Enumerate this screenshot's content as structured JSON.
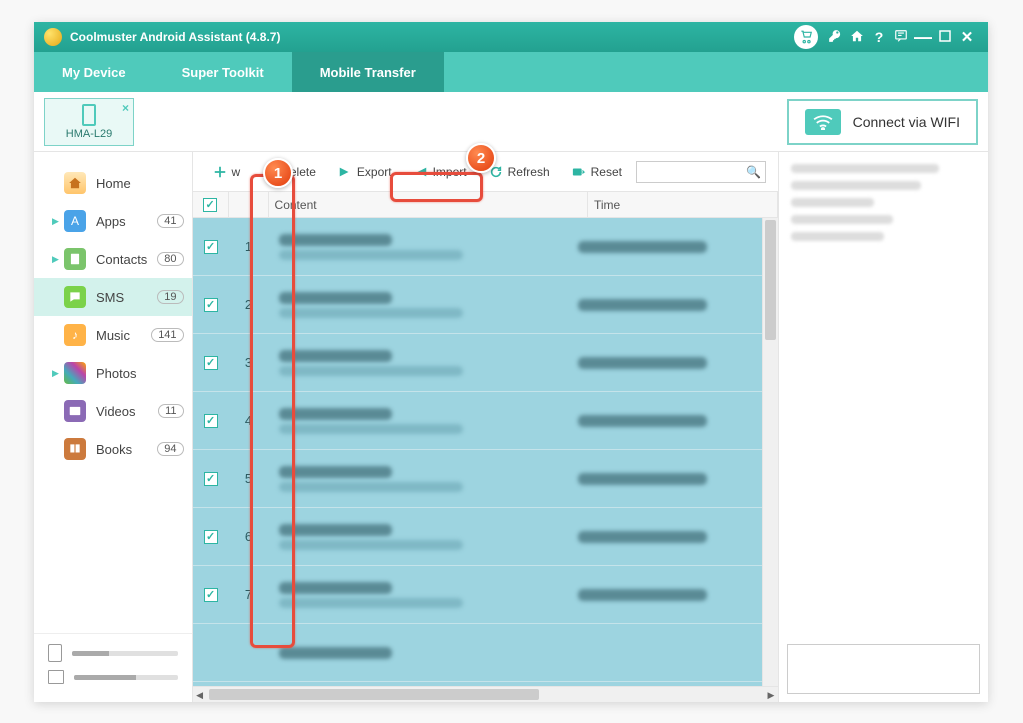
{
  "app": {
    "title": "Coolmuster Android Assistant (4.8.7)"
  },
  "tabs": {
    "my_device": "My Device",
    "super_toolkit": "Super Toolkit",
    "mobile_transfer": "Mobile Transfer"
  },
  "device": {
    "name": "HMA-L29"
  },
  "wifi_button": "Connect via WIFI",
  "sidebar": {
    "items": [
      {
        "label": "Home",
        "count": null,
        "arrow": false
      },
      {
        "label": "Apps",
        "count": "41",
        "arrow": true
      },
      {
        "label": "Contacts",
        "count": "80",
        "arrow": true
      },
      {
        "label": "SMS",
        "count": "19",
        "arrow": false
      },
      {
        "label": "Music",
        "count": "141",
        "arrow": false
      },
      {
        "label": "Photos",
        "count": null,
        "arrow": true
      },
      {
        "label": "Videos",
        "count": "11",
        "arrow": false
      },
      {
        "label": "Books",
        "count": "94",
        "arrow": false
      }
    ]
  },
  "toolbar": {
    "new": "w",
    "delete": "Delete",
    "export": "Export",
    "import": "Import",
    "refresh": "Refresh",
    "reset": "Reset"
  },
  "table": {
    "headers": {
      "content": "Content",
      "time": "Time"
    },
    "rows": [
      {
        "idx": "1"
      },
      {
        "idx": "2"
      },
      {
        "idx": "3"
      },
      {
        "idx": "4"
      },
      {
        "idx": "5"
      },
      {
        "idx": "6"
      },
      {
        "idx": "7"
      }
    ]
  },
  "storage": {
    "internal_pct": 35,
    "sd_pct": 60
  },
  "annotations": {
    "c1": "1",
    "c2": "2"
  }
}
